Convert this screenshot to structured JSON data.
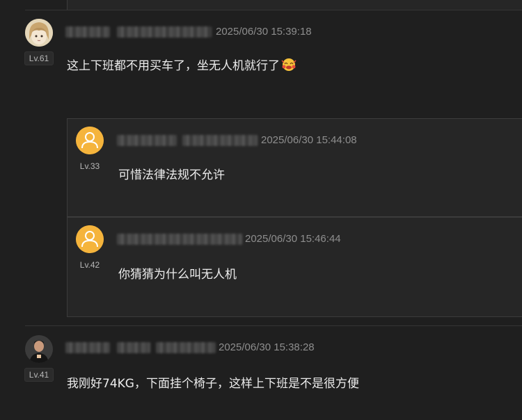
{
  "comments": [
    {
      "level": "Lv.61",
      "timestamp": "2025/06/30 15:39:18",
      "text": "这上下班都不用买车了，坐无人机就行了",
      "emoji": "smiling-face-emoji",
      "replies": [
        {
          "level": "Lv.33",
          "timestamp": "2025/06/30 15:44:08",
          "text": "可惜法律法规不允许"
        },
        {
          "level": "Lv.42",
          "timestamp": "2025/06/30 15:46:44",
          "text": "你猜猜为什么叫无人机"
        }
      ]
    },
    {
      "level": "Lv.41",
      "timestamp": "2025/06/30 15:38:28",
      "text": "我刚好74KG，下面挂个椅子，这样上下班是不是很方便"
    }
  ],
  "colors": {
    "background": "#1f1f1f",
    "reply_background": "#262626",
    "default_avatar": "#f5b43c",
    "timestamp": "#8e8e8e"
  }
}
